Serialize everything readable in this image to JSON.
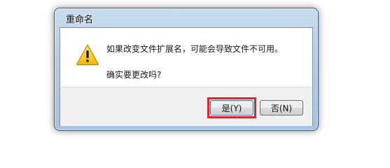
{
  "dialog": {
    "title": "重命名",
    "message_line1": "如果改变文件扩展名，可能会导致文件不可用。",
    "message_line2": "确实要更改吗?",
    "icon": "warning-icon",
    "buttons": {
      "yes_label": "是(Y)",
      "no_label": "否(N)"
    },
    "highlight_color": "#e3242b"
  }
}
